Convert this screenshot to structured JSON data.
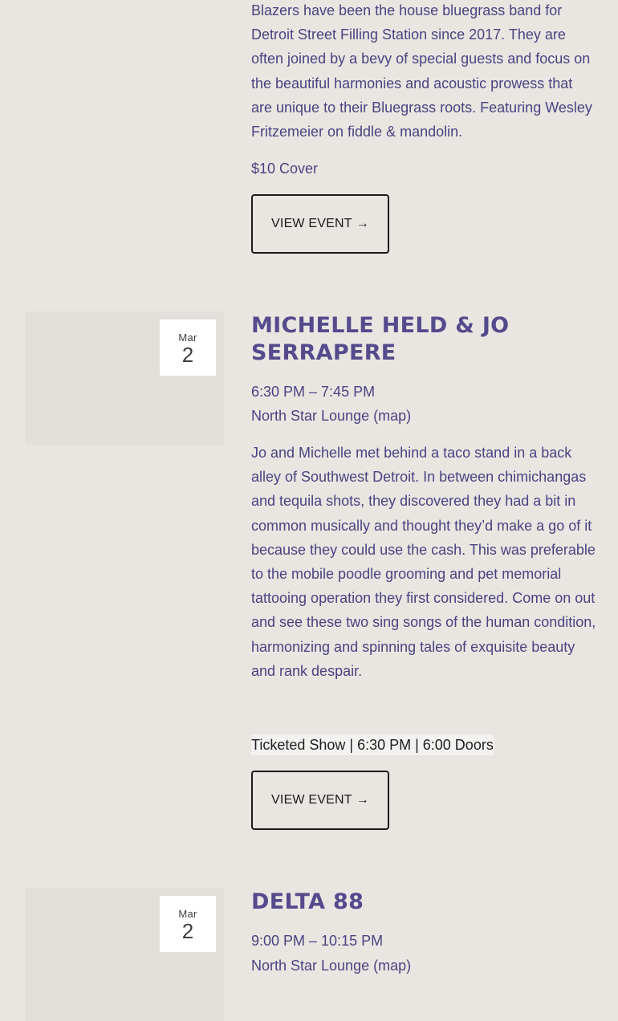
{
  "events": [
    {
      "description": "Blazers have been the house bluegrass band for Detroit Street Filling Station since 2017. They are often joined by a bevy of special guests and focus on the beautiful harmonies and acoustic prowess that are unique to their Bluegrass roots. Featuring Wesley Fritzemeier on fiddle & mandolin.",
      "cover": "$10 Cover",
      "button_label": "VIEW EVENT",
      "button_arrow": "→"
    },
    {
      "month": "Mar",
      "day": "2",
      "title": "Michelle Held & Jo Serrapere",
      "time": "6:30 PM – 7:45 PM",
      "venue": "North Star Lounge",
      "map_label": "(map)",
      "description": "Jo and Michelle met behind a taco stand in a back alley of Southwest Detroit. In between chimichangas and tequila shots, they discovered they had a bit in common musically and thought they’d make a go of it because they could use the cash. This was preferable to the mobile poodle grooming and pet memorial tattooing operation they first considered. Come on out and see these two sing songs of the human condition, harmonizing and spinning tales of exquisite beauty and rank despair.",
      "ticket_info": "Ticketed Show | 6:30 PM | 6:00 Doors",
      "button_label": "VIEW EVENT",
      "button_arrow": "→"
    },
    {
      "month": "Mar",
      "day": "2",
      "title": "Delta 88",
      "time": "9:00 PM – 10:15 PM",
      "venue": "North Star Lounge",
      "map_label": "(map)"
    }
  ]
}
